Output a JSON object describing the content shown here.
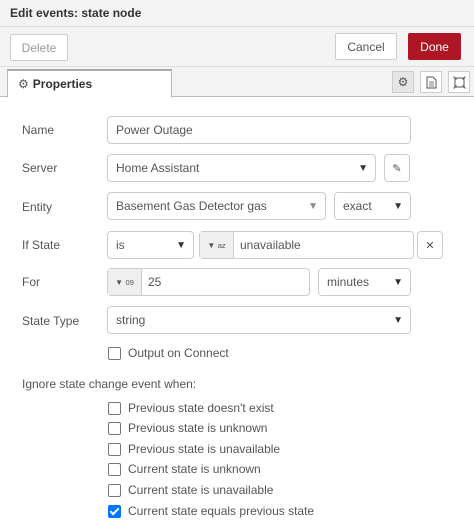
{
  "header": {
    "title": "Edit events: state node"
  },
  "toolbar": {
    "delete_label": "Delete",
    "cancel_label": "Cancel",
    "done_label": "Done"
  },
  "tabs": {
    "properties_label": "Properties"
  },
  "form": {
    "name": {
      "label": "Name",
      "value": "Power Outage"
    },
    "server": {
      "label": "Server",
      "value": "Home Assistant"
    },
    "entity": {
      "label": "Entity",
      "value": "Basement Gas Detector gas",
      "match": "exact"
    },
    "if_state": {
      "label": "If State",
      "operator": "is",
      "type_glyph": "a",
      "type_sub": "z",
      "value": "unavailable"
    },
    "for": {
      "label": "For",
      "type_glyph": "0",
      "type_sub": "9",
      "value": "25",
      "unit": "minutes"
    },
    "state_type": {
      "label": "State Type",
      "value": "string"
    },
    "output_on_connect": {
      "label": "Output on Connect",
      "checked": false
    }
  },
  "ignore": {
    "heading": "Ignore state change event when:",
    "options": [
      {
        "label": "Previous state doesn't exist",
        "checked": false
      },
      {
        "label": "Previous state is unknown",
        "checked": false
      },
      {
        "label": "Previous state is unavailable",
        "checked": false
      },
      {
        "label": "Current state is unknown",
        "checked": false
      },
      {
        "label": "Current state is unavailable",
        "checked": false
      },
      {
        "label": "Current state equals previous state",
        "checked": true
      }
    ]
  },
  "colors": {
    "done_bg": "#ad1625",
    "checkbox_checked": "#0075ff"
  },
  "icons": [
    "gear-icon",
    "description-icon",
    "appearance-icon",
    "pencil-icon",
    "close-icon",
    "chevron-down-icon"
  ]
}
